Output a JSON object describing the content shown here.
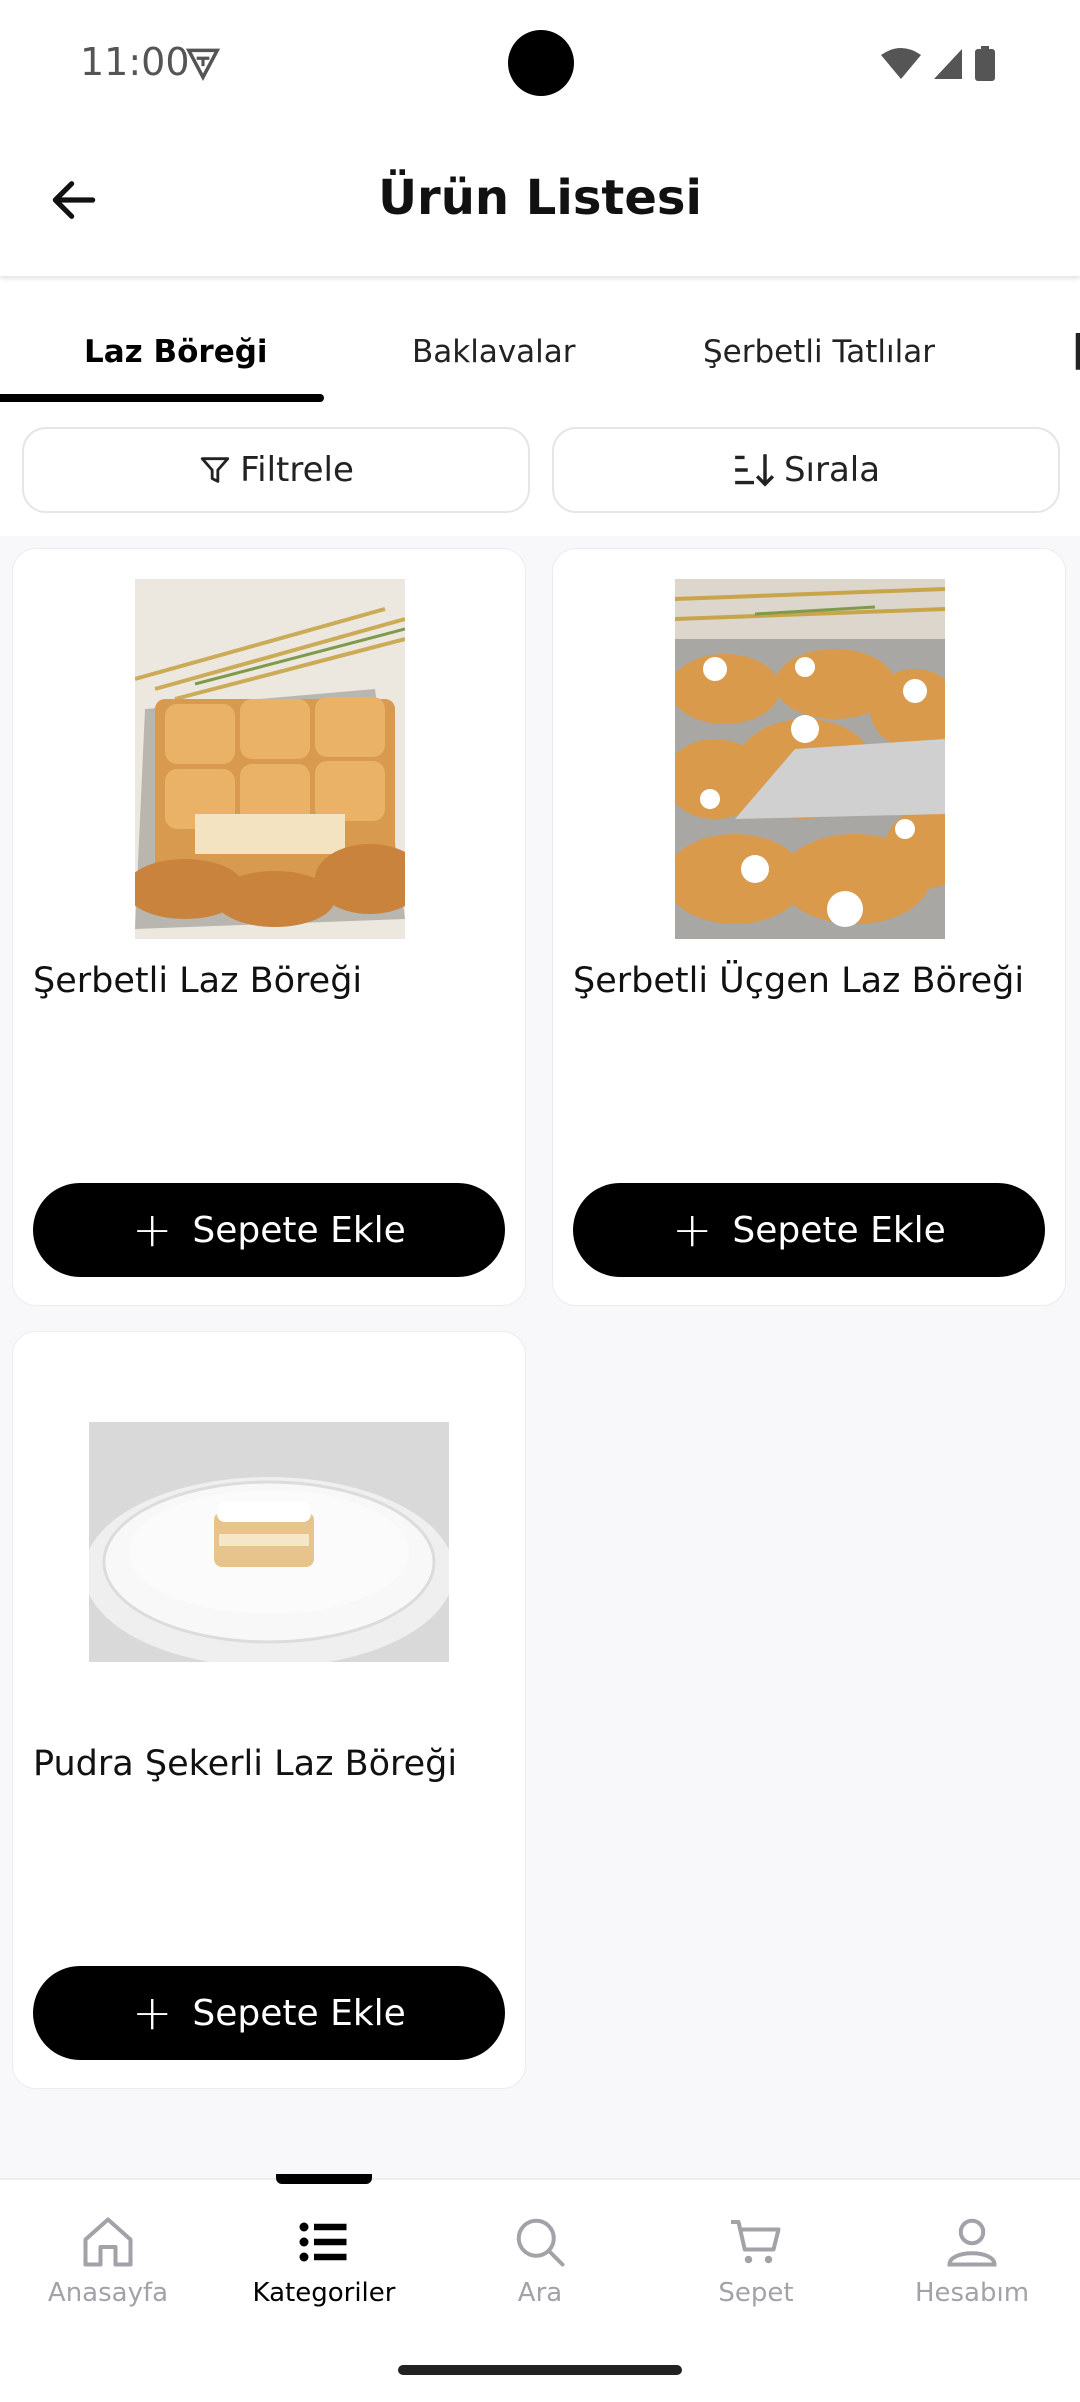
{
  "status": {
    "time": "11:00"
  },
  "header": {
    "title": "Ürün Listesi"
  },
  "tabs": [
    "Laz Böreği",
    "Baklavalar",
    "Şerbetli Tatlılar"
  ],
  "filter": {
    "label": "Filtrele"
  },
  "sort": {
    "label": "Sırala"
  },
  "products": [
    {
      "name": "Şerbetli Laz Böreği",
      "button": "Sepete Ekle"
    },
    {
      "name": "Şerbetli Üçgen Laz Böreği",
      "button": "Sepete Ekle"
    },
    {
      "name": "Pudra Şekerli Laz Böreği",
      "button": "Sepete Ekle"
    }
  ],
  "nav": [
    {
      "label": "Anasayfa",
      "icon": "home-icon"
    },
    {
      "label": "Kategoriler",
      "icon": "list-icon"
    },
    {
      "label": "Ara",
      "icon": "search-icon"
    },
    {
      "label": "Sepet",
      "icon": "cart-icon"
    },
    {
      "label": "Hesabım",
      "icon": "user-icon"
    }
  ],
  "colors": {
    "accent": "#000000",
    "muted": "#a2a2a8",
    "background": "#f8f8fb"
  }
}
